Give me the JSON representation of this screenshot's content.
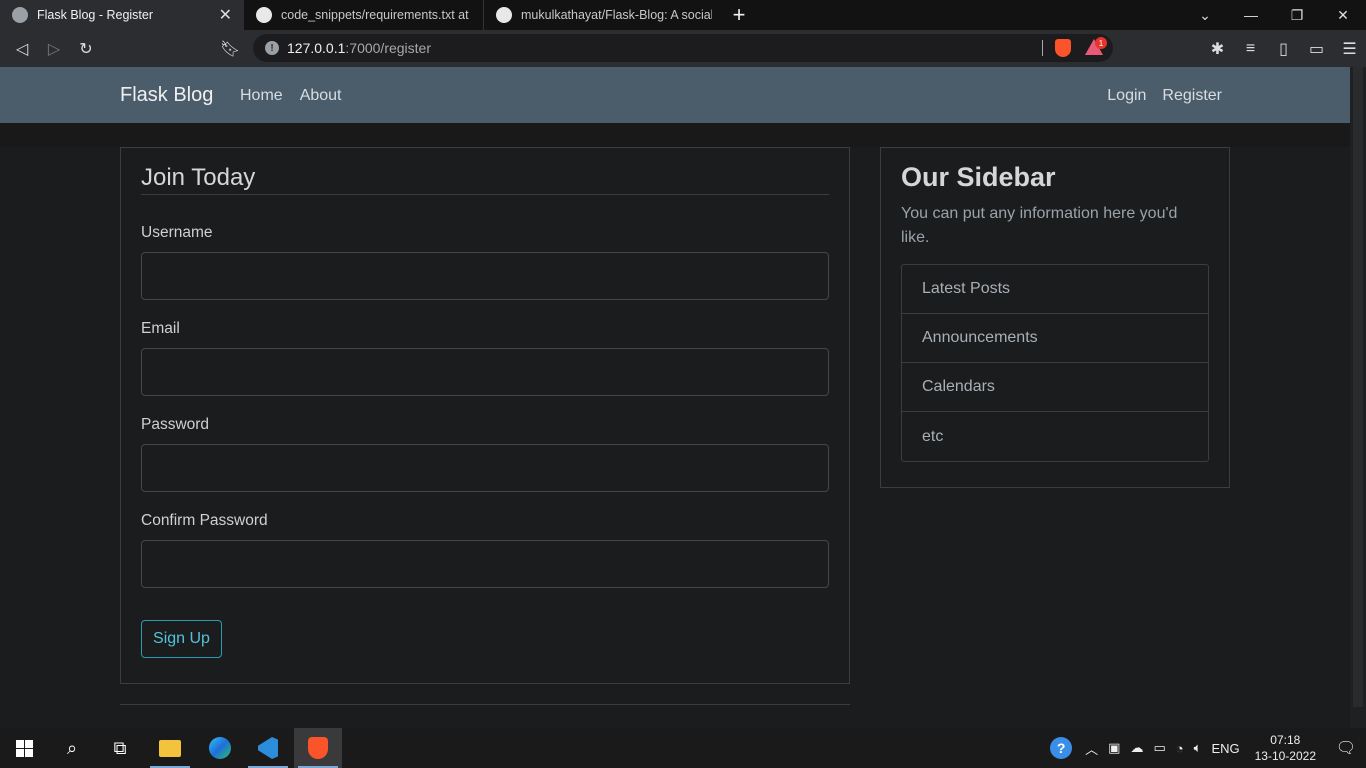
{
  "browser": {
    "tabs": [
      {
        "title": "Flask Blog - Register",
        "icon": "globe-icon",
        "active": true
      },
      {
        "title": "code_snippets/requirements.txt at ma",
        "icon": "github-icon",
        "active": false
      },
      {
        "title": "mukulkathayat/Flask-Blog: A social me",
        "icon": "github-icon",
        "active": false
      }
    ],
    "new_tab_label": "+",
    "tab_close_label": "✕",
    "window_controls": [
      "⌄",
      "—",
      "❐",
      "✕"
    ],
    "url_host": "127.0.0.1",
    "url_path": ":7000/register",
    "brave_badge": "1"
  },
  "site": {
    "brand": "Flask Blog",
    "nav_left": [
      "Home",
      "About"
    ],
    "nav_right": [
      "Login",
      "Register"
    ]
  },
  "form": {
    "legend": "Join Today",
    "fields": [
      {
        "label": "Username",
        "value": ""
      },
      {
        "label": "Email",
        "value": ""
      },
      {
        "label": "Password",
        "value": ""
      },
      {
        "label": "Confirm Password",
        "value": ""
      }
    ],
    "submit_label": "Sign Up"
  },
  "sidebar": {
    "title": "Our Sidebar",
    "text": "You can put any information here you'd like.",
    "items": [
      "Latest Posts",
      "Announcements",
      "Calendars",
      "etc"
    ]
  },
  "taskbar": {
    "language": "ENG",
    "time": "07:18",
    "date": "13-10-2022"
  },
  "colors": {
    "navbar": "#4b5d6b",
    "page_bg": "#1b1c1e",
    "accent_button": "#2a9ab2"
  }
}
